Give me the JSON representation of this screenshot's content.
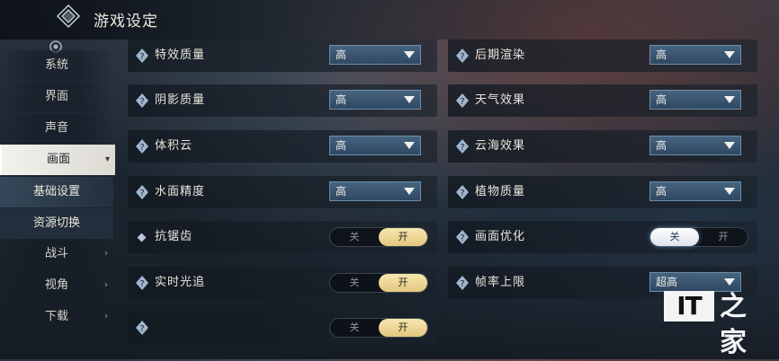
{
  "header": {
    "title": "游戏设定"
  },
  "sidebar": {
    "items": [
      {
        "label": "系统",
        "arrow": ""
      },
      {
        "label": "界面",
        "arrow": ""
      },
      {
        "label": "声音",
        "arrow": ""
      },
      {
        "label": "画面",
        "arrow": "▾"
      },
      {
        "label": "基础设置",
        "arrow": ""
      },
      {
        "label": "资源切换",
        "arrow": ""
      },
      {
        "label": "战斗",
        "arrow": "›"
      },
      {
        "label": "视角",
        "arrow": "›"
      },
      {
        "label": "下载",
        "arrow": "›"
      }
    ]
  },
  "settings": {
    "effects_quality": {
      "label": "特效质量",
      "value": "高"
    },
    "shadow_quality": {
      "label": "阴影质量",
      "value": "高"
    },
    "volumetric_cloud": {
      "label": "体积云",
      "value": "高"
    },
    "water_precision": {
      "label": "水面精度",
      "value": "高"
    },
    "anti_aliasing": {
      "label": "抗锯齿",
      "off": "关",
      "on": "开",
      "state": "开"
    },
    "ray_tracing": {
      "label": "实时光追",
      "off": "关",
      "on": "开",
      "state": "开"
    },
    "unnamed_toggle": {
      "label": "",
      "off": "关",
      "on": "开",
      "state": "开"
    },
    "post_processing": {
      "label": "后期渲染",
      "value": "高"
    },
    "weather_effects": {
      "label": "天气效果",
      "value": "高"
    },
    "cloud_sea_effects": {
      "label": "云海效果",
      "value": "高"
    },
    "vegetation_quality": {
      "label": "植物质量",
      "value": "高"
    },
    "image_optimization": {
      "label": "画面优化",
      "off": "关",
      "on": "开",
      "state": "关"
    },
    "frame_rate_limit": {
      "label": "帧率上限",
      "value": "超高"
    }
  },
  "watermark": {
    "it": "IT",
    "home": "之家"
  },
  "colors": {
    "toggle_on": "#e2c77f",
    "dropdown": "#2f4862",
    "active_nav": "#f2f1ec"
  }
}
